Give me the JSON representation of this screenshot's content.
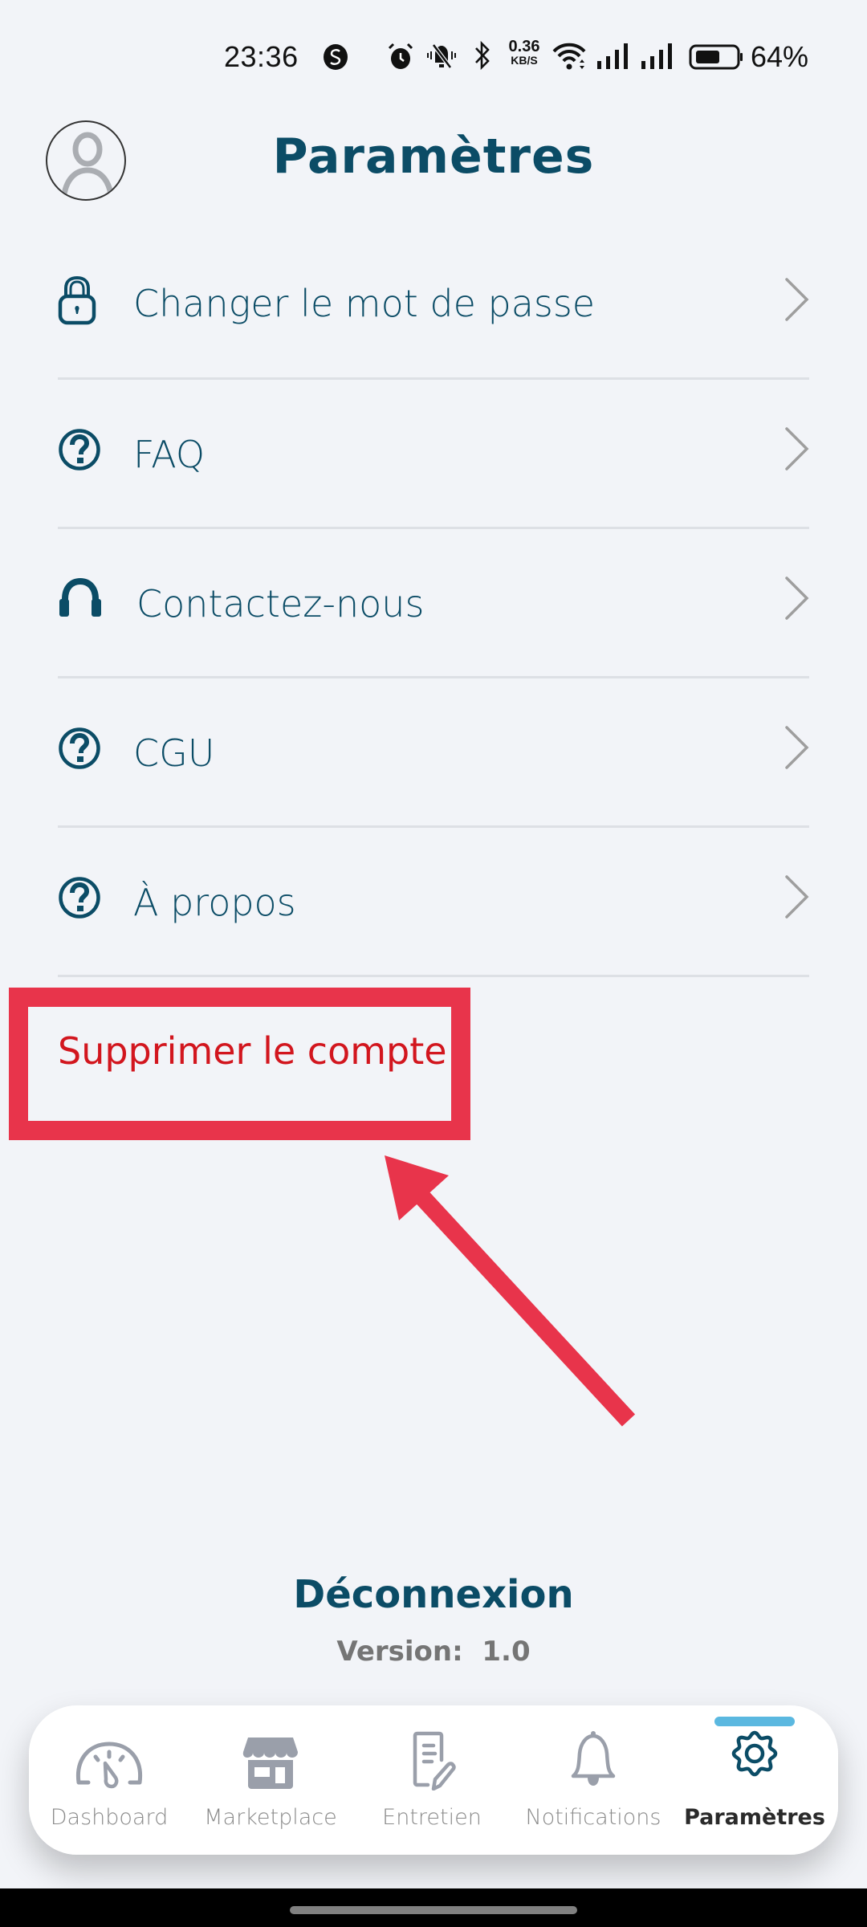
{
  "status_bar": {
    "time": "23:36",
    "net_speed_value": "0.36",
    "net_speed_unit": "KB/S",
    "battery_percent": "64%",
    "battery_level": 0.64,
    "icons": [
      "app-s-icon",
      "alarm-icon",
      "bell-muted-icon",
      "bluetooth-icon",
      "wifi-icon",
      "signal-icon",
      "signal-icon",
      "battery-icon"
    ]
  },
  "header": {
    "title": "Paramètres",
    "avatar_icon": "user-avatar-icon"
  },
  "settings": {
    "items": [
      {
        "label": "Changer le mot de passe",
        "icon": "lock-icon"
      },
      {
        "label": "FAQ",
        "icon": "question-circle-icon"
      },
      {
        "label": "Contactez-nous",
        "icon": "headphones-icon"
      },
      {
        "label": "CGU",
        "icon": "question-circle-icon"
      },
      {
        "label": "À propos",
        "icon": "question-circle-icon"
      }
    ],
    "chevron_icon": "chevron-right-icon",
    "delete_account": "Supprimer le compte"
  },
  "annotation": {
    "highlight_color": "#E8344B",
    "target": "Supprimer le compte"
  },
  "footer": {
    "logout": "Déconnexion",
    "version": "Version:  1.0"
  },
  "bottom_nav": {
    "tabs": [
      {
        "label": "Dashboard",
        "icon": "speedometer-icon",
        "active": false
      },
      {
        "label": "Marketplace",
        "icon": "store-icon",
        "active": false
      },
      {
        "label": "Entretien",
        "icon": "document-edit-icon",
        "active": false
      },
      {
        "label": "Notifications",
        "icon": "bell-icon",
        "active": false
      },
      {
        "label": "Paramètres",
        "icon": "gear-icon",
        "active": true
      }
    ],
    "active_indicator_color": "#5BB8E0"
  },
  "colors": {
    "primary": "#0B4C66",
    "danger_text": "#D2161E",
    "background": "#F2F4F8",
    "inactive_icon": "#9A9FAA"
  }
}
